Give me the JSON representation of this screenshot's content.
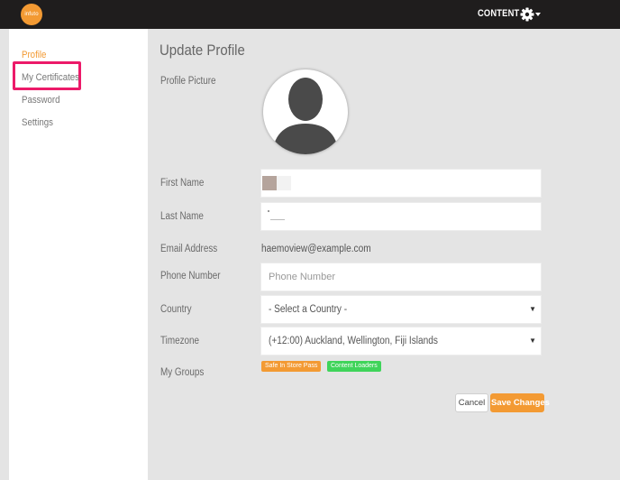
{
  "header": {
    "logo_text": "infuto",
    "nav_content": "CONTENT",
    "settings_icon": "gear-icon",
    "dropdown_icon": "caret-down-icon"
  },
  "sidebar": {
    "items": [
      {
        "label": "Profile",
        "active": true
      },
      {
        "label": "My Certificates",
        "active": false,
        "highlighted": true
      },
      {
        "label": "Password",
        "active": false
      },
      {
        "label": "Settings",
        "active": false
      }
    ]
  },
  "main": {
    "title": "Update Profile",
    "profile_picture_label": "Profile Picture",
    "first_name": {
      "label": "First Name",
      "value": ""
    },
    "last_name": {
      "label": "Last Name",
      "value": ""
    },
    "email": {
      "label": "Email Address",
      "value": "haemoview@example.com"
    },
    "phone": {
      "label": "Phone Number",
      "value": "",
      "placeholder": "Phone Number"
    },
    "country": {
      "label": "Country",
      "selected": "- Select a Country -"
    },
    "timezone": {
      "label": "Timezone",
      "selected": "(+12:00) Auckland, Wellington, Fiji Islands"
    },
    "groups": {
      "label": "My Groups",
      "items": [
        {
          "name": "Safe In Store Pass",
          "color": "#f39a33"
        },
        {
          "name": "Content Loaders",
          "color": "#3fd45a"
        }
      ]
    },
    "buttons": {
      "cancel": "Cancel",
      "save": "Save Changes"
    }
  },
  "colors": {
    "accent": "#f39a33",
    "highlight": "#ec1a69",
    "topbar": "#1f1d1d"
  }
}
